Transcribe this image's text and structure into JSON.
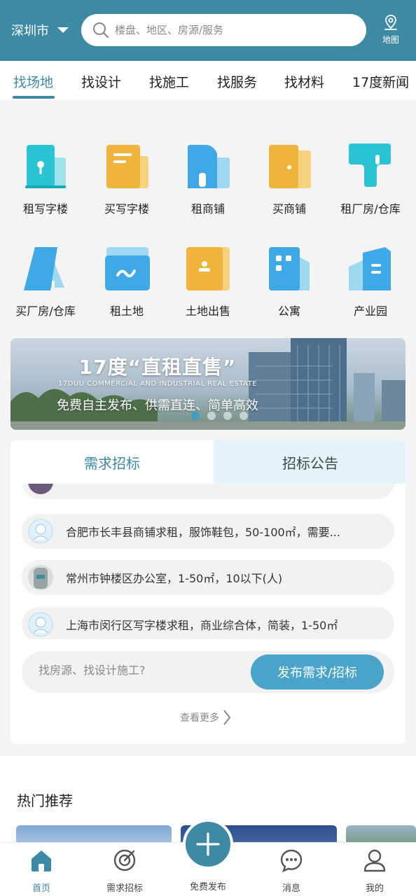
{
  "header": {
    "city": "深圳市",
    "search_placeholder": "楼盘、地区、房源/服务",
    "map_label": "地图"
  },
  "tabs": [
    {
      "label": "找场地",
      "active": true
    },
    {
      "label": "找设计"
    },
    {
      "label": "找施工"
    },
    {
      "label": "找服务"
    },
    {
      "label": "找材料"
    },
    {
      "label": "17度新闻"
    }
  ],
  "categories": [
    {
      "label": "租写字楼",
      "icon": "office-rent-icon"
    },
    {
      "label": "买写字楼",
      "icon": "office-buy-icon"
    },
    {
      "label": "租商铺",
      "icon": "shop-rent-icon"
    },
    {
      "label": "买商铺",
      "icon": "shop-buy-icon"
    },
    {
      "label": "租厂房/仓库",
      "icon": "factory-rent-icon"
    },
    {
      "label": "买厂房/仓库",
      "icon": "factory-buy-icon"
    },
    {
      "label": "租土地",
      "icon": "land-rent-icon"
    },
    {
      "label": "土地出售",
      "icon": "land-sale-icon"
    },
    {
      "label": "公寓",
      "icon": "apartment-icon"
    },
    {
      "label": "产业园",
      "icon": "industrial-park-icon"
    }
  ],
  "banner": {
    "title": "17度“直租直售”",
    "subtitle_en": "17DUU  COMMERCIAL AND INDUSTRIAL REAL ESTATE",
    "subtitle": "免费自主发布、供需直连、简单高效",
    "slides": 4,
    "active_slide": 0
  },
  "demand": {
    "tab_active": "需求招标",
    "tab_other": "招标公告",
    "items": [
      "合肥市长丰县商铺求租，服饰鞋包，50-100㎡，需要...",
      "常州市钟楼区办公室，1-50㎡，10以下(人)",
      "上海市闵行区写字楼求租，商业综合体，简装，1-50㎡"
    ],
    "input_placeholder": "找房源、找设计施工?",
    "publish_button": "发布需求/招标",
    "more": "查看更多"
  },
  "hot": {
    "title": "热门推荐"
  },
  "bottom_nav": [
    {
      "label": "首页",
      "icon": "home-icon",
      "active": true
    },
    {
      "label": "需求招标",
      "icon": "target-icon"
    },
    {
      "label": "免费发布",
      "icon": "plus-icon"
    },
    {
      "label": "消息",
      "icon": "message-icon"
    },
    {
      "label": "我的",
      "icon": "user-icon"
    }
  ],
  "colors": {
    "primary": "#3e8aa5",
    "accent_button": "#4aa4c9",
    "icon_teal": "#2bc4d2",
    "icon_yellow": "#f0b43c",
    "icon_blue": "#3ea9e6"
  }
}
